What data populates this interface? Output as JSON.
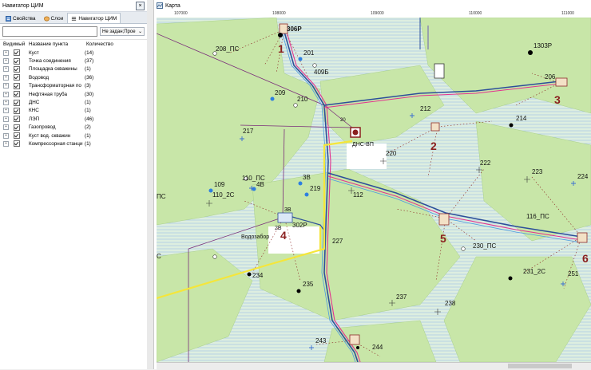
{
  "left_panel": {
    "title": "Навигатор ЦИМ",
    "tabs": [
      {
        "label": "Свойства"
      },
      {
        "label": "Слои"
      },
      {
        "label": "Навигатор ЦИМ"
      }
    ],
    "search_value": "",
    "dropdown_value": "Не задан;Прое",
    "columns": {
      "visible": "Видимый",
      "name": "Название пункта",
      "count": "Количество"
    },
    "items": [
      {
        "name": "Куст",
        "count": "(14)"
      },
      {
        "name": "Точка соединения",
        "count": "(37)"
      },
      {
        "name": "Площадка скважины",
        "count": "(1)"
      },
      {
        "name": "Водовод",
        "count": "(36)"
      },
      {
        "name": "Трансформаторная по",
        "count": "(3)"
      },
      {
        "name": "Нефтяная труба",
        "count": "(30)"
      },
      {
        "name": "ДНС",
        "count": "(1)"
      },
      {
        "name": "КНС",
        "count": "(1)"
      },
      {
        "name": "ЛЭП",
        "count": "(46)"
      },
      {
        "name": "Газопровод",
        "count": "(2)"
      },
      {
        "name": "Куст вод. скважин",
        "count": "(1)"
      },
      {
        "name": "Компрессорная станци",
        "count": "(1)"
      }
    ]
  },
  "map_panel": {
    "title": "Карта",
    "ruler_labels": [
      "107000",
      "108000",
      "109000",
      "110000",
      "111000"
    ],
    "labels": {
      "l306p": "306Р",
      "l208ps": "208_ПС",
      "l201": "201",
      "l409b": "409Б",
      "l209": "209",
      "l210": "210",
      "l1303p": "1303Р",
      "l206": "206",
      "l212": "212",
      "l214": "214",
      "l217": "217",
      "l220": "220",
      "dns": "ДНС-ВП",
      "l222": "222",
      "l223": "223",
      "l224": "224",
      "l109": "109",
      "l110ps": "110_ПС",
      "l4v": "4В",
      "l110_2s": "110_2С",
      "l3v": "3В",
      "l219": "219",
      "l112": "112",
      "l116ps": "116_ПС",
      "l3v2": "3В",
      "l302p": "302Р",
      "l2v": "2В",
      "vodozabor": "Водозабор",
      "l227": "227",
      "l230ps": "230_ПС",
      "l234": "234",
      "l231_2s": "231_2С",
      "l251": "251",
      "l235": "235",
      "l237": "237",
      "l238": "238",
      "l243": "243",
      "l244": "244",
      "ps_left": "ПС",
      "c_left": "С",
      "l20": "20"
    },
    "pad_numbers": {
      "p1": "1",
      "p2": "2",
      "p3": "3",
      "p4": "4",
      "p5": "5",
      "p6": "6"
    }
  }
}
